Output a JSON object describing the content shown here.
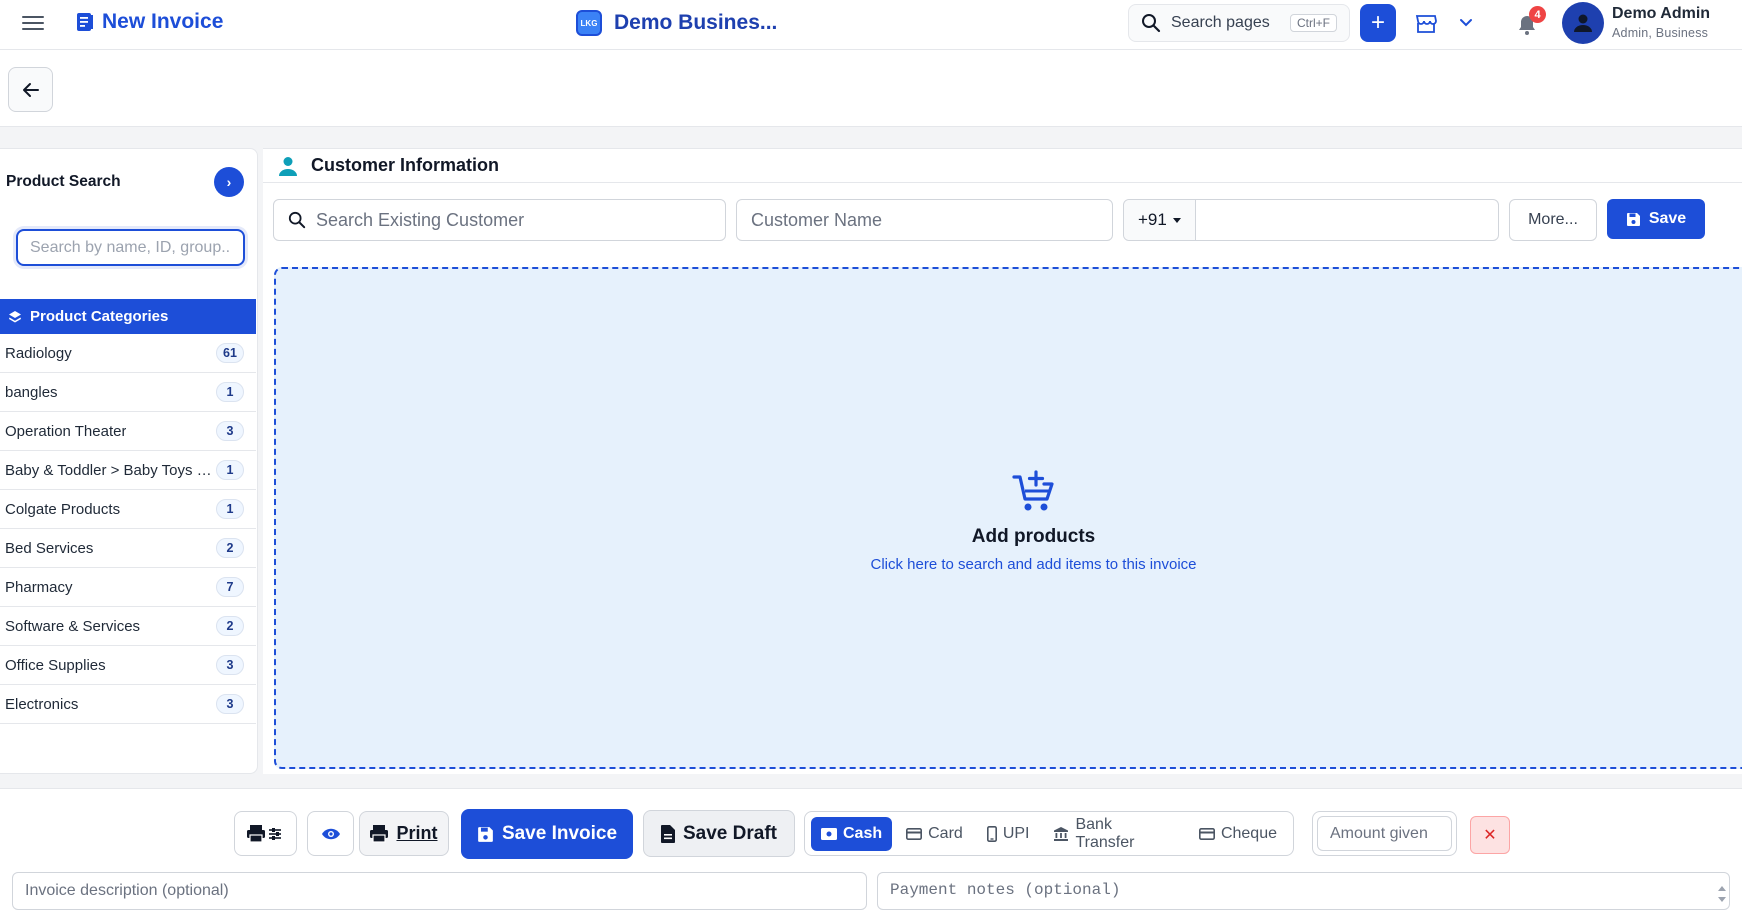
{
  "topbar": {
    "page_title": "New Invoice",
    "business_logo_text": "LKG",
    "business_name": "Demo Busines...",
    "search_label": "Search pages",
    "search_shortcut": "Ctrl+F",
    "add_label": "+",
    "notification_count": "4",
    "user_name": "Demo Admin",
    "user_role": "Admin, Business"
  },
  "product_search": {
    "title": "Product Search",
    "go_label": "›",
    "placeholder": "Search by name, ID, group..."
  },
  "categories": {
    "header": "Product Categories",
    "items": [
      {
        "name": "Radiology",
        "count": "61"
      },
      {
        "name": "bangles",
        "count": "1"
      },
      {
        "name": "Operation Theater",
        "count": "3"
      },
      {
        "name": "Baby & Toddler > Baby Toys & Activity Equipment",
        "count": "1"
      },
      {
        "name": "Colgate Products",
        "count": "1"
      },
      {
        "name": "Bed Services",
        "count": "2"
      },
      {
        "name": "Pharmacy",
        "count": "7"
      },
      {
        "name": "Software & Services",
        "count": "2"
      },
      {
        "name": "Office Supplies",
        "count": "3"
      },
      {
        "name": "Electronics",
        "count": "3"
      }
    ]
  },
  "customer": {
    "title": "Customer Information",
    "search_placeholder": "Search Existing Customer",
    "name_placeholder": "Customer Name",
    "country_code": "+91",
    "phone_value": "",
    "more_label": "More...",
    "save_label": "Save"
  },
  "dropzone": {
    "title": "Add products",
    "subtitle": "Click here to search and add items to this invoice"
  },
  "bottom": {
    "print_label": "Print",
    "save_invoice_label": "Save Invoice",
    "save_draft_label": "Save Draft",
    "payment_methods": [
      {
        "label": "Cash",
        "active": true
      },
      {
        "label": "Card",
        "active": false
      },
      {
        "label": "UPI",
        "active": false
      },
      {
        "label": "Bank Transfer",
        "active": false
      },
      {
        "label": "Cheque",
        "active": false
      }
    ],
    "amount_placeholder": "Amount given",
    "clear_label": "✕",
    "description_placeholder": "Invoice description (optional)",
    "notes_placeholder": "Payment notes (optional)"
  },
  "colors": {
    "primary": "#1d4ed8",
    "dropzone_bg": "#e6f1fc",
    "danger": "#dc2626",
    "badge_red": "#ef4444"
  }
}
